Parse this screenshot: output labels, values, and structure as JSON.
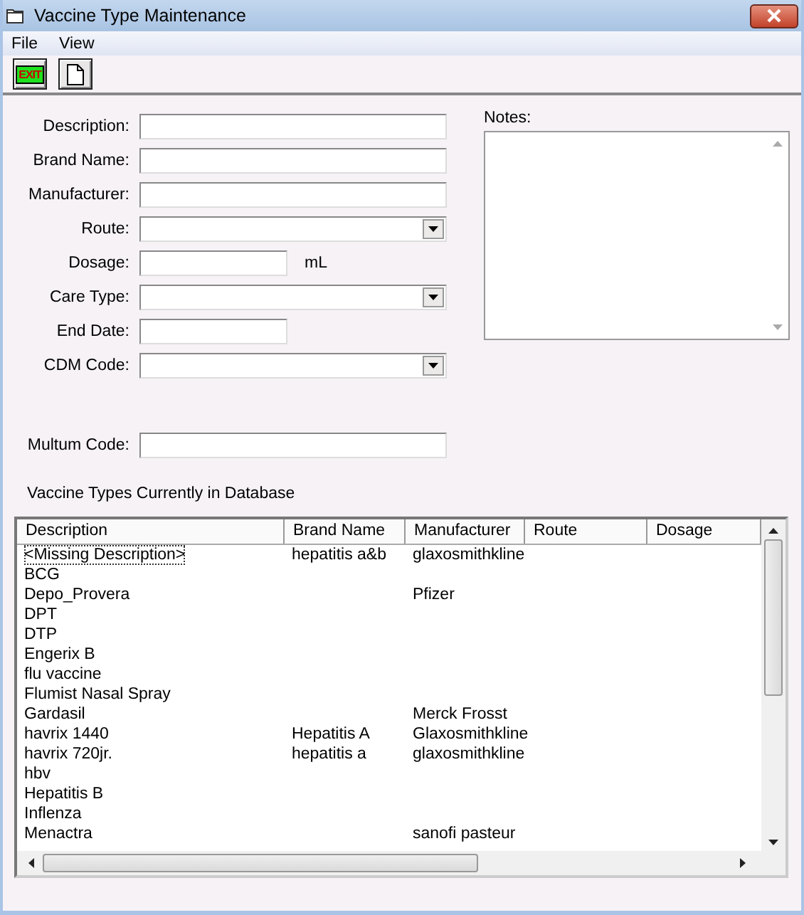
{
  "window": {
    "title": "Vaccine Type Maintenance"
  },
  "menu": [
    "File",
    "View"
  ],
  "toolbar": [
    {
      "kind": "exit",
      "label": "EXIT"
    },
    {
      "kind": "new"
    }
  ],
  "fields": [
    {
      "label": "Description:",
      "kind": "text"
    },
    {
      "label": "Brand Name:",
      "kind": "text"
    },
    {
      "label": "Manufacturer:",
      "kind": "text"
    },
    {
      "label": "Route:",
      "kind": "combo"
    },
    {
      "label": "Dosage:",
      "kind": "short",
      "unit": "mL"
    },
    {
      "label": "Care Type:",
      "kind": "combo"
    },
    {
      "label": "End Date:",
      "kind": "short"
    },
    {
      "label": "CDM Code:",
      "kind": "combo"
    }
  ],
  "more_fields": [
    {
      "label": "Multum Code:"
    }
  ],
  "notes": {
    "label": "Notes:"
  },
  "list": {
    "title": "Vaccine Types Currently in Database",
    "columns": [
      "Description",
      "Brand Name",
      "Manufacturer",
      "Route",
      "Dosage"
    ],
    "rows": [
      {
        "cells": [
          "<Missing Description>",
          "hepatitis a&b",
          "glaxosmithkline"
        ],
        "selected": true
      },
      {
        "cells": [
          "BCG"
        ],
        "selected": false
      },
      {
        "cells": [
          "Depo_Provera",
          null,
          "Pfizer"
        ],
        "selected": false
      },
      {
        "cells": [
          "DPT"
        ],
        "selected": false
      },
      {
        "cells": [
          "DTP"
        ],
        "selected": false
      },
      {
        "cells": [
          "Engerix B"
        ],
        "selected": false
      },
      {
        "cells": [
          "flu vaccine"
        ],
        "selected": false
      },
      {
        "cells": [
          "Flumist Nasal Spray"
        ],
        "selected": false
      },
      {
        "cells": [
          "Gardasil",
          null,
          "Merck Frosst"
        ],
        "selected": false
      },
      {
        "cells": [
          "havrix 1440",
          "Hepatitis A",
          "Glaxosmithkline"
        ],
        "selected": false
      },
      {
        "cells": [
          "havrix 720jr.",
          "hepatitis a",
          "glaxosmithkline"
        ],
        "selected": false
      },
      {
        "cells": [
          "hbv"
        ],
        "selected": false
      },
      {
        "cells": [
          "Hepatitis B"
        ],
        "selected": false
      },
      {
        "cells": [
          "Inflenza"
        ],
        "selected": false
      },
      {
        "cells": [
          "Menactra",
          null,
          "sanofi pasteur"
        ],
        "selected": false
      }
    ]
  }
}
